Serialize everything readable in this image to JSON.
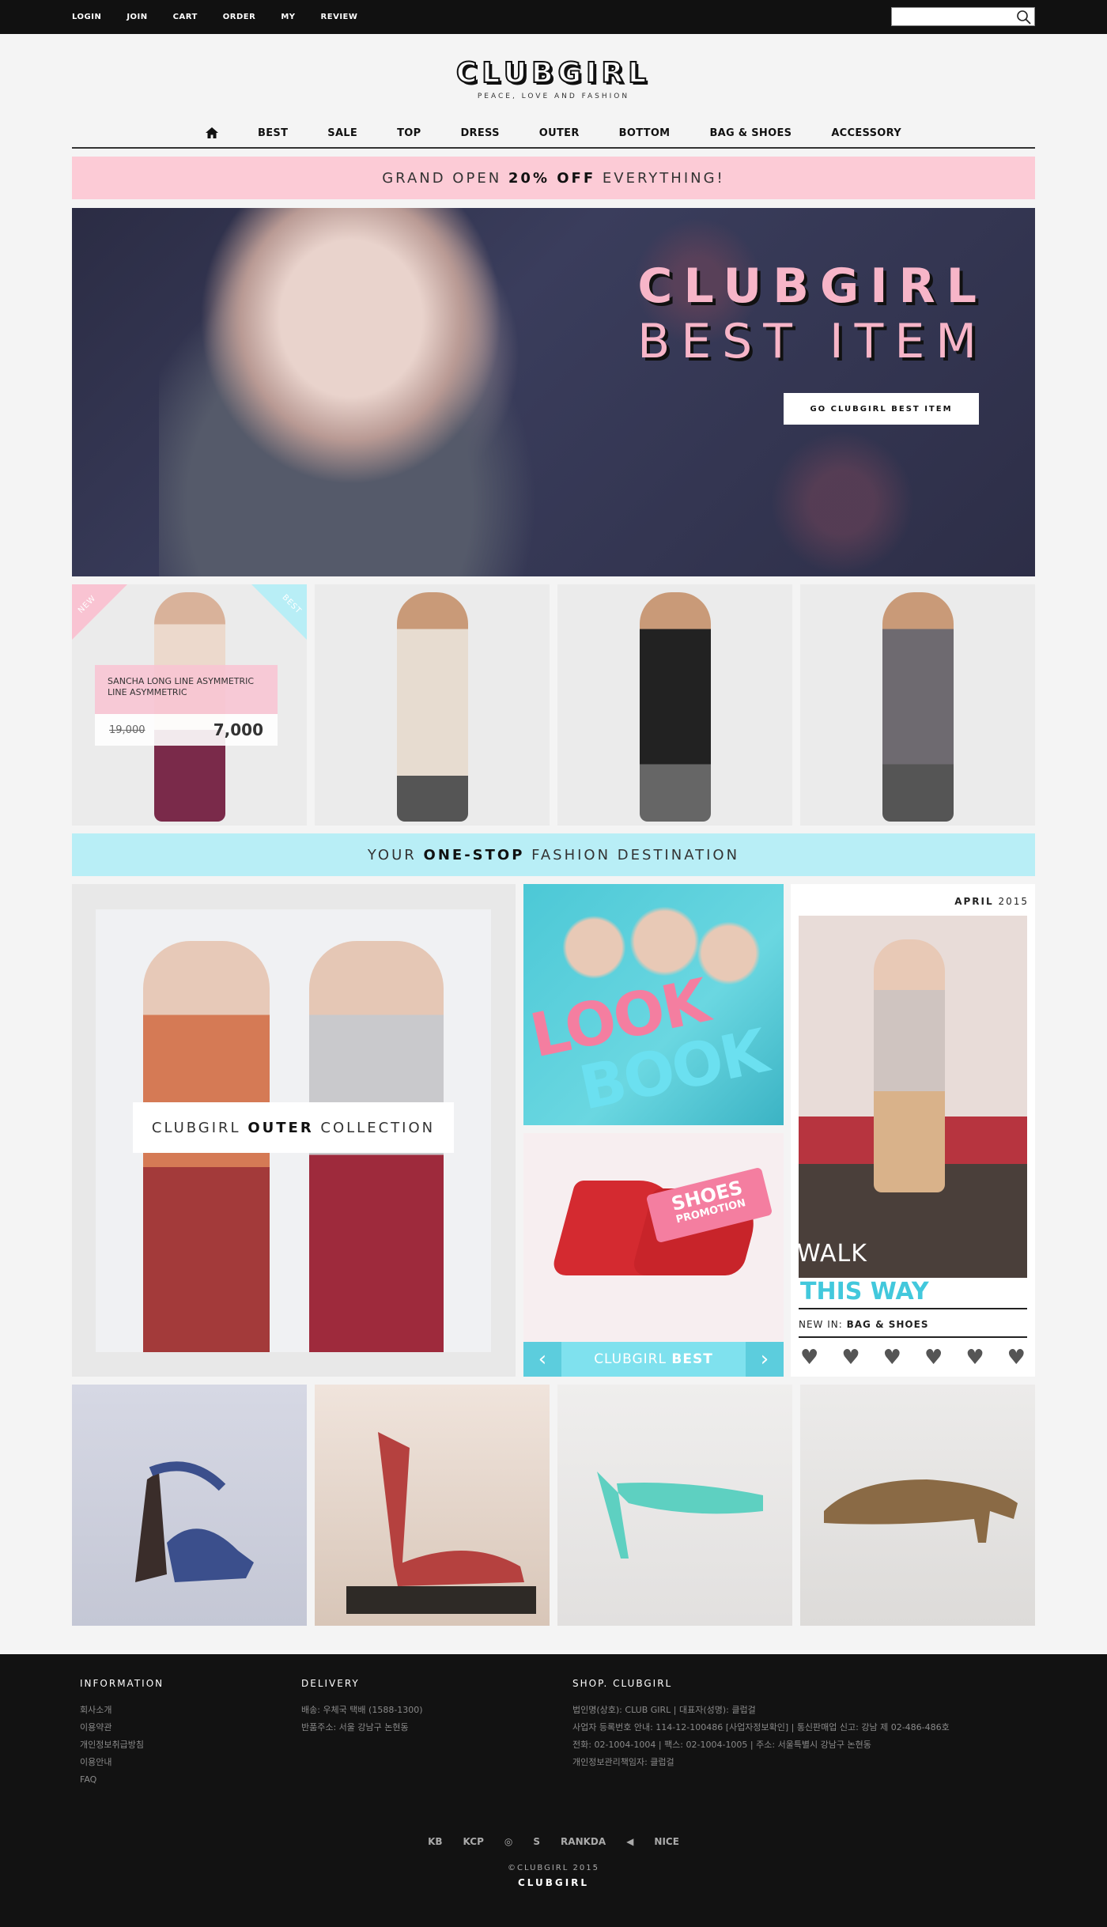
{
  "topbar": {
    "links": [
      "LOGIN",
      "JOIN",
      "CART",
      "ORDER",
      "MY",
      "REVIEW"
    ],
    "search_placeholder": ""
  },
  "logo": {
    "name": "CLUBGIRL",
    "tagline": "PEACE, LOVE AND FASHION"
  },
  "nav": {
    "items": [
      "BEST",
      "SALE",
      "TOP",
      "DRESS",
      "OUTER",
      "BOTTOM",
      "BAG & SHOES",
      "ACCESSORY"
    ]
  },
  "promo_top": {
    "pre": "GRAND OPEN ",
    "bold": "20% OFF",
    "post": " EVERYTHING!"
  },
  "hero": {
    "line1": "CLUBGIRL",
    "line2": "BEST ITEM",
    "cta": "GO CLUBGIRL BEST ITEM"
  },
  "featured_product": {
    "badge_new": "NEW",
    "badge_best": "BEST",
    "name": "SANCHA LONG LINE ASYMMETRIC LINE ASYMMETRIC",
    "old_price": "19,000",
    "price": "7,000"
  },
  "promo_mid": {
    "pre": "YOUR ",
    "bold": "ONE-STOP",
    "post": " FASHION DESTINATION"
  },
  "outer": {
    "pre": "CLUBGIRL ",
    "bold": "OUTER",
    "post": " COLLECTION"
  },
  "lookbook": {
    "line1": "LOOK",
    "line2": "BOOK"
  },
  "shoes_promo": {
    "line1": "SHOES",
    "line2": "PROMOTION",
    "bar_pre": "CLUBGIRL ",
    "bar_bold": "BEST"
  },
  "walk": {
    "month": "APRIL",
    "year": "2015",
    "line1": "WALK",
    "line2": "THIS WAY",
    "newin_pre": "NEW IN: ",
    "newin_bold": "BAG & SHOES"
  },
  "footer": {
    "info_title": "INFORMATION",
    "info_items": [
      "회사소개",
      "이용약관",
      "개인정보취급방침",
      "이용안내",
      "FAQ"
    ],
    "delivery_title": "DELIVERY",
    "delivery_items": [
      "배송: 우체국 택배 (1588-1300)",
      "반품주소: 서울 강남구 논현동"
    ],
    "shop_title": "SHOP. CLUBGIRL",
    "shop_items": [
      "법인명(상호): CLUB GIRL | 대표자(성명): 클럽걸",
      "사업자 등록번호 안내: 114-12-100486 [사업자정보확인] | 통신판매업 신고: 강남 제 02-486-486호",
      "전화: 02-1004-1004 | 팩스: 02-1004-1005 | 주소: 서울특별시 강남구 논현동",
      "개인정보관리책임자: 클럽걸"
    ],
    "partner_logos": [
      "KB",
      "KCP",
      "◎",
      "S",
      "RANKDA",
      "◀",
      "NICE"
    ],
    "copyright": "©CLUBGIRL 2015",
    "brand": "CLUBGIRL"
  }
}
